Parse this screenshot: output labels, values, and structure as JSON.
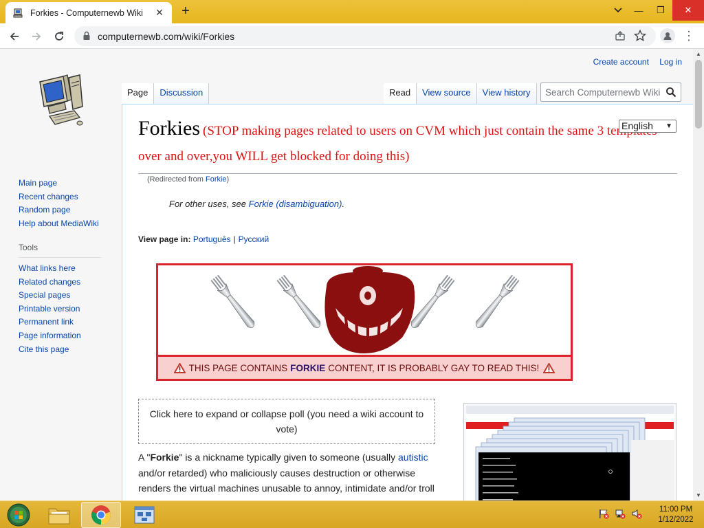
{
  "browser": {
    "tab_title": "Forkies - Computernewb Wiki",
    "new_tab_symbol": "+",
    "url": "computernewb.com/wiki/Forkies",
    "window_controls": {
      "minimize": "—",
      "restore": "❐",
      "close": "✕"
    }
  },
  "wiki": {
    "personal": {
      "create_account": "Create account",
      "log_in": "Log in"
    },
    "tabs_left": [
      "Page",
      "Discussion"
    ],
    "tabs_right": [
      "Read",
      "View source",
      "View history"
    ],
    "search_placeholder": "Search Computernewb Wiki",
    "sidebar": {
      "nav": [
        "Main page",
        "Recent changes",
        "Random page",
        "Help about MediaWiki"
      ],
      "tools_heading": "Tools",
      "tools": [
        "What links here",
        "Related changes",
        "Special pages",
        "Printable version",
        "Permanent link",
        "Page information",
        "Cite this page"
      ]
    },
    "heading": {
      "title": "Forkies",
      "warning": "(STOP making pages related to users on CVM which just contain the same 3 templates over and over,you WILL get blocked for doing this)"
    },
    "language_select": "English",
    "redirect": {
      "prefix": "(Redirected from ",
      "link": "Forkie",
      "suffix": ")"
    },
    "hatnote": {
      "text": "For other uses, see ",
      "link": "Forkie (disambiguation)",
      "suffix": "."
    },
    "view_in": {
      "label": "View page in:",
      "langs": [
        "Português",
        "Русский"
      ]
    },
    "banner": {
      "pre": "THIS PAGE CONTAINS ",
      "bold": "FORKIE",
      "post": " CONTENT, IT IS PROBABLY GAY TO READ THIS!",
      "colors": {
        "border": "#d9242b",
        "bar": "#f8d0cf",
        "face": "#8b0f0f"
      }
    },
    "poll_text": "Click here to expand or collapse poll (you need a wiki account to vote)",
    "body": {
      "p1_a": "A \"",
      "p1_bold": "Forkie",
      "p1_b": "\" is a nickname typically given to someone (usually ",
      "p1_link": "autistic",
      "p1_c": " and/or retarded) who maliciously causes destruction or otherwise renders the virtual machines unusable to annoy, intimidate and/or troll"
    }
  },
  "taskbar": {
    "time": "11:00 PM",
    "date": "1/12/2022"
  }
}
